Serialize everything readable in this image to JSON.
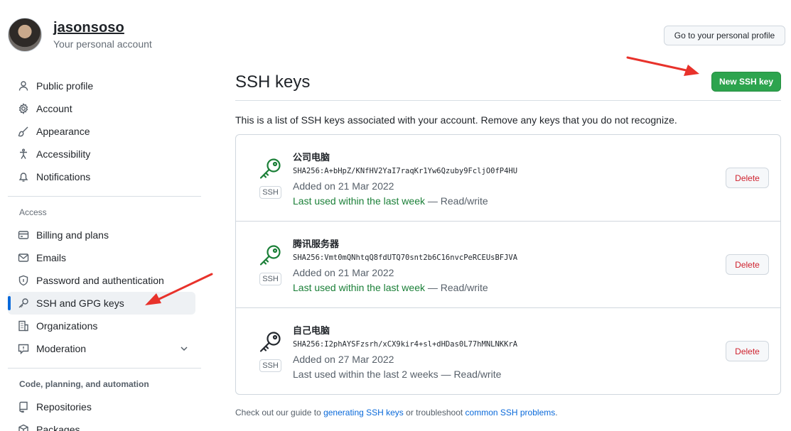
{
  "user": {
    "name": "jasonsoso",
    "subtitle": "Your personal account",
    "profile_button": "Go to your personal profile"
  },
  "sidebar": {
    "items": [
      {
        "label": "Public profile",
        "icon": "person-icon"
      },
      {
        "label": "Account",
        "icon": "gear-icon"
      },
      {
        "label": "Appearance",
        "icon": "paintbrush-icon"
      },
      {
        "label": "Accessibility",
        "icon": "accessibility-icon"
      },
      {
        "label": "Notifications",
        "icon": "bell-icon"
      }
    ],
    "access_title": "Access",
    "access_items": [
      {
        "label": "Billing and plans",
        "icon": "credit-card-icon"
      },
      {
        "label": "Emails",
        "icon": "mail-icon"
      },
      {
        "label": "Password and authentication",
        "icon": "shield-lock-icon"
      },
      {
        "label": "SSH and GPG keys",
        "icon": "key-icon",
        "active": true
      },
      {
        "label": "Organizations",
        "icon": "organization-icon"
      },
      {
        "label": "Moderation",
        "icon": "report-icon"
      }
    ],
    "code_title": "Code, planning, and automation",
    "code_items": [
      {
        "label": "Repositories",
        "icon": "repo-icon"
      },
      {
        "label": "Packages",
        "icon": "package-icon"
      }
    ]
  },
  "main": {
    "title": "SSH keys",
    "new_button": "New SSH key",
    "intro": "This is a list of SSH keys associated with your account. Remove any keys that you do not recognize.",
    "badge": "SSH",
    "delete_label": "Delete",
    "keys": [
      {
        "name": "公司电脑",
        "fingerprint": "SHA256:A+bHpZ/KNfHV2YaI7raqKr1Yw6Qzuby9FcljO0fP4HU",
        "added": "Added on 21 Mar 2022",
        "used_recent": "Last used within the last week",
        "used_mode": " — Read/write",
        "icon_color": "#1a7f37"
      },
      {
        "name": "腾讯服务器",
        "fingerprint": "SHA256:Vmt0mQNhtqQ8fdUTQ70snt2b6C16nvcPeRCEUsBFJVA",
        "added": "Added on 21 Mar 2022",
        "used_recent": "Last used within the last week",
        "used_mode": " — Read/write",
        "icon_color": "#1a7f37"
      },
      {
        "name": "自己电脑",
        "fingerprint": "SHA256:I2phAYSFzsrh/xCX9kir4+sl+dHDas0L77hMNLNKKrA",
        "added": "Added on 27 Mar 2022",
        "used_recent": "",
        "used_mode": "Last used within the last 2 weeks — Read/write",
        "icon_color": "#24292f"
      }
    ],
    "footer": {
      "prefix": "Check out our guide to ",
      "link1": "generating SSH keys",
      "middle": " or troubleshoot ",
      "link2": "common SSH problems",
      "suffix": "."
    }
  },
  "colors": {
    "primary_button": "#2da44e",
    "active_indicator": "#0969da",
    "danger": "#cf222e",
    "annotation_arrow": "#e8322b"
  }
}
